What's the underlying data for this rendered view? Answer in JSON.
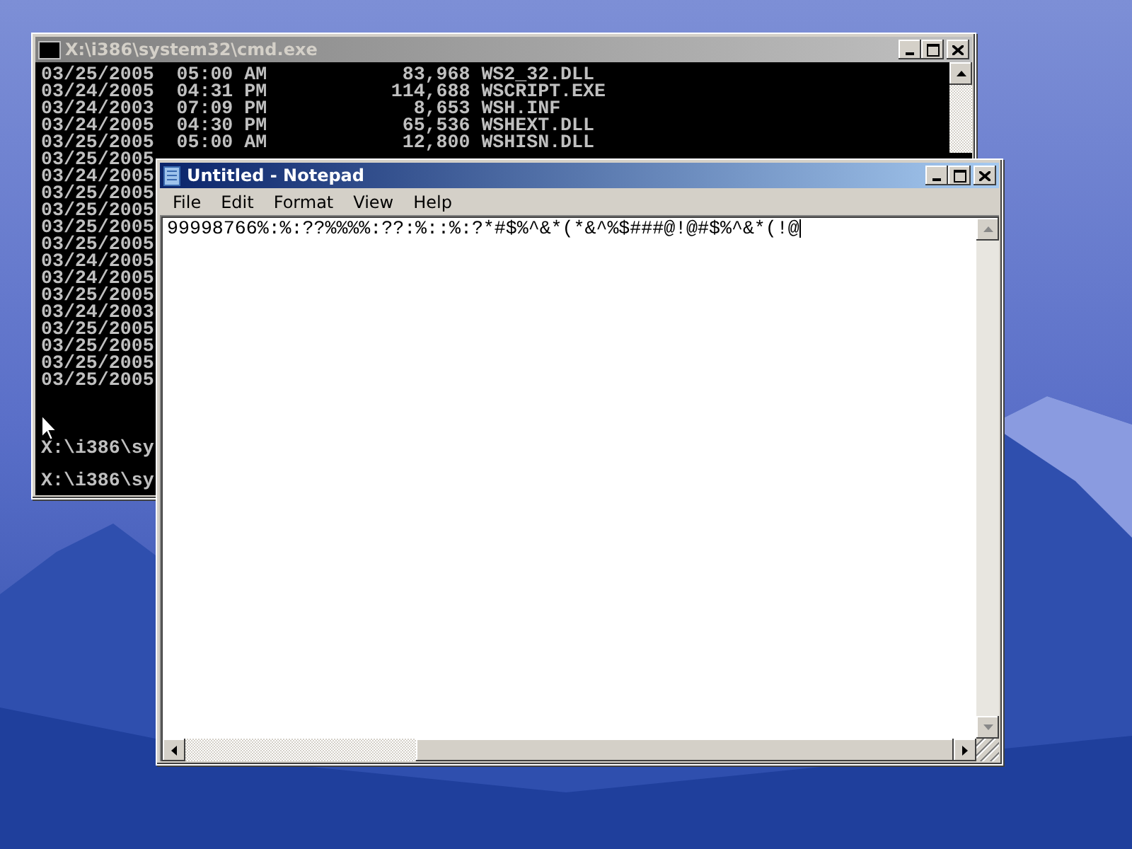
{
  "console_window": {
    "title": "X:\\i386\\system32\\cmd.exe",
    "active": false,
    "lines": [
      "03/25/2005  05:00 AM            83,968 WS2_32.DLL",
      "03/24/2005  04:31 PM           114,688 WSCRIPT.EXE",
      "03/24/2003  07:09 PM             8,653 WSH.INF",
      "03/24/2005  04:30 PM            65,536 WSHEXT.DLL",
      "03/25/2005  05:00 AM            12,800 WSHISN.DLL",
      "03/25/2005",
      "03/24/2005",
      "03/25/2005",
      "03/25/2005",
      "03/25/2005",
      "03/25/2005",
      "03/24/2005",
      "03/24/2005",
      "03/25/2005",
      "03/24/2003",
      "03/25/2005",
      "03/25/2005",
      "03/25/2005",
      "03/25/2005"
    ],
    "prompts": [
      "X:\\i386\\sy",
      "X:\\i386\\sy"
    ]
  },
  "notepad_window": {
    "title": "Untitled - Notepad",
    "active": true,
    "menu": [
      "File",
      "Edit",
      "Format",
      "View",
      "Help"
    ],
    "text": "99998766%:%:??%%%%:??:%::%:?*#$%^&*(*&^%$###@!@#$%^&*(!@"
  }
}
